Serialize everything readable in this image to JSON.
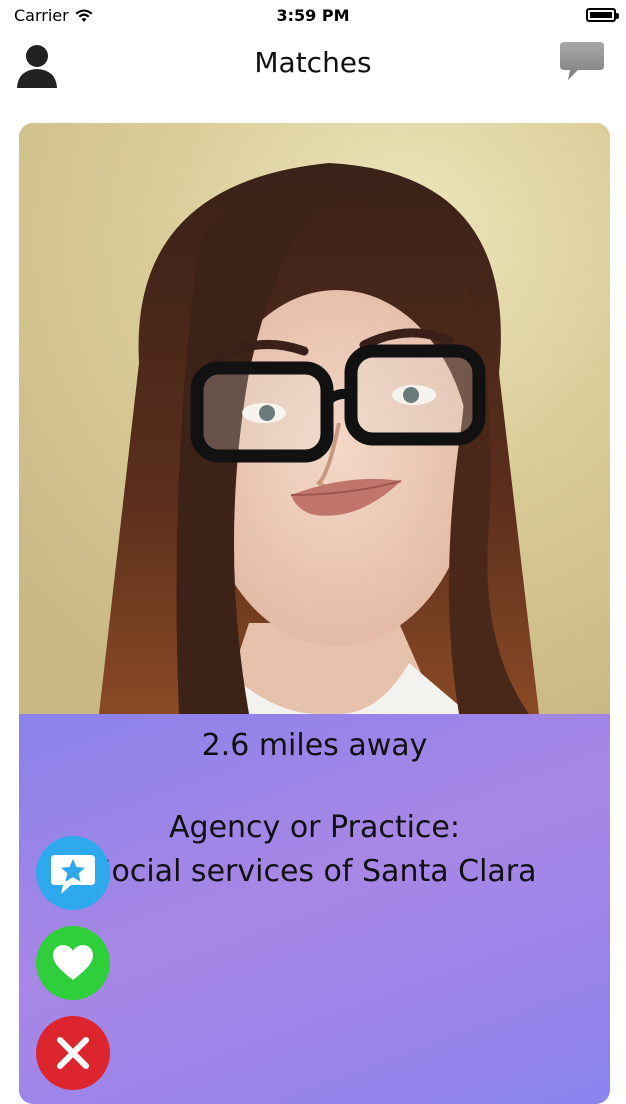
{
  "status_bar": {
    "carrier": "Carrier",
    "time": "3:59 PM"
  },
  "header": {
    "title": "Matches"
  },
  "icons": {
    "profile": "person-silhouette-icon",
    "chat": "chat-bubble-icon",
    "superlike": "star-message-icon",
    "like": "heart-icon",
    "dislike": "close-x-icon"
  },
  "card": {
    "distance": "2.6 miles away",
    "agency_label": "Agency or Practice:",
    "agency_value": "Social services of Santa Clara"
  },
  "colors": {
    "superlike": "#2ea9ee",
    "like": "#2ecf3a",
    "dislike": "#dd2530",
    "info_gradient_start": "#8a82ea",
    "info_gradient_end": "#a887e6"
  }
}
